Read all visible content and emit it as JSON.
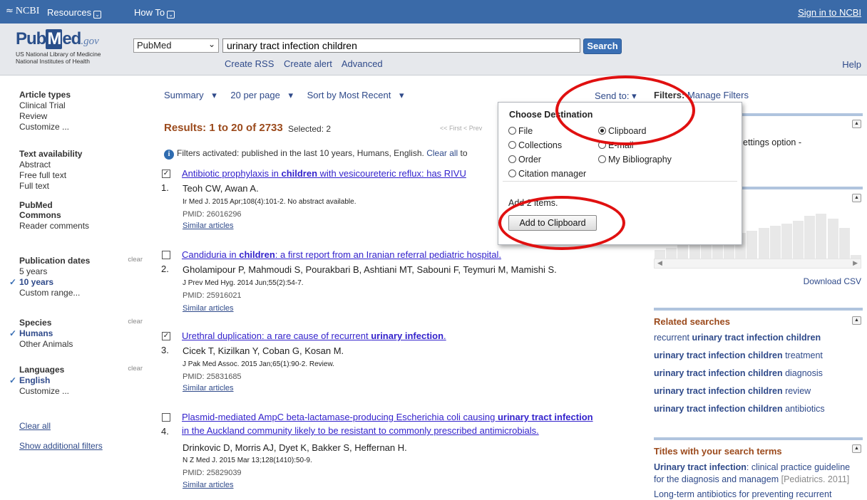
{
  "topbar": {
    "ncbi": "NCBI",
    "resources": "Resources",
    "howto": "How To",
    "signin": "Sign in to NCBI"
  },
  "header": {
    "logo_pub": "Pub",
    "logo_m": "M",
    "logo_ed": "ed",
    "logo_gov": ".gov",
    "lib1": "US National Library of Medicine",
    "lib2": "National Institutes of Health",
    "db": "PubMed",
    "query": "urinary tract infection children",
    "search": "Search",
    "create_rss": "Create RSS",
    "create_alert": "Create alert",
    "advanced": "Advanced",
    "help": "Help"
  },
  "filters_left": {
    "article_types": {
      "heading": "Article types",
      "items": [
        "Clinical Trial",
        "Review",
        "Customize ..."
      ]
    },
    "text_availability": {
      "heading": "Text availability",
      "items": [
        "Abstract",
        "Free full text",
        "Full text"
      ]
    },
    "pubmed_commons": {
      "heading1": "PubMed",
      "heading2": "Commons",
      "items": [
        "Reader comments"
      ]
    },
    "publication_dates": {
      "heading": "Publication dates",
      "clear": "clear",
      "items": [
        "5 years",
        "10 years",
        "Custom range..."
      ],
      "selected": "10 years"
    },
    "species": {
      "heading": "Species",
      "clear": "clear",
      "items": [
        "Humans",
        "Other Animals"
      ],
      "selected": "Humans"
    },
    "languages": {
      "heading": "Languages",
      "clear": "clear",
      "items": [
        "English",
        "Customize ..."
      ],
      "selected": "English"
    },
    "clear_all": "Clear all",
    "show_additional": "Show additional filters"
  },
  "display": {
    "format": "Summary",
    "per_page": "20 per page",
    "sort": "Sort by Most Recent",
    "send_to": "Send to:"
  },
  "results": {
    "text": "Results: 1 to 20 of 2733",
    "selected": "Selected: 2",
    "pager": "<< First   < Prev"
  },
  "filter_info": {
    "text": "Filters activated: published in the last 10 years, Humans, English.",
    "clear_all": "Clear all",
    "suffix": "to"
  },
  "articles": [
    {
      "num": "1.",
      "checked": true,
      "title_a": "Antibiotic prophylaxis in ",
      "title_b": "children",
      "title_c": " with vesicoureteric reflux: has RIVU",
      "authors": "Teoh CW, Awan A.",
      "journal": "Ir Med J. 2015 Apr;108(4):101-2. No abstract available.",
      "pmid": "PMID: 26016296",
      "similar": "Similar articles"
    },
    {
      "num": "2.",
      "checked": false,
      "title_a": "Candiduria in ",
      "title_b": "children",
      "title_c": ": a first report from an Iranian referral pediatric hospital.",
      "authors": "Gholamipour P, Mahmoudi S, Pourakbari B, Ashtiani MT, Sabouni F, Teymuri M, Mamishi S.",
      "journal": "J Prev Med Hyg. 2014 Jun;55(2):54-7.",
      "pmid": "PMID: 25916021",
      "similar": "Similar articles"
    },
    {
      "num": "3.",
      "checked": true,
      "title_a": "Urethral duplication: a rare cause of recurrent ",
      "title_b": "urinary infection",
      "title_c": ".",
      "authors": "Cicek T, Kizilkan Y, Coban G, Kosan M.",
      "journal": "J Pak Med Assoc. 2015 Jan;65(1):90-2. Review.",
      "pmid": "PMID: 25831685",
      "similar": "Similar articles"
    },
    {
      "num": "4.",
      "checked": false,
      "title_a": "Plasmid-mediated AmpC beta-lactamase-producing Escherichia coli causing ",
      "title_b": "urinary tract infection",
      "title_c": "",
      "title_line2": "in the Auckland community likely to be resistant to commonly prescribed antimicrobials.",
      "authors": "Drinkovic D, Morris AJ, Dyet K, Bakker S, Heffernan H.",
      "journal": "N Z Med J. 2015 Mar 13;128(1410):50-9.",
      "pmid": "PMID: 25829039",
      "similar": "Similar articles"
    }
  ],
  "popup": {
    "heading": "Choose Destination",
    "options": [
      "File",
      "Clipboard",
      "Collections",
      "E-mail",
      "Order",
      "My Bibliography",
      "Citation manager"
    ],
    "selected": "Clipboard",
    "add_items": "Add 2 items.",
    "button": "Add to Clipboard"
  },
  "right": {
    "filters_label": "Filters:",
    "manage": "Manage Filters",
    "settings_text": "ettings option -",
    "download_csv": "Download CSV",
    "histogram_levels": [
      0.25,
      0.3,
      0.35,
      0.4,
      0.45,
      0.5,
      0.55,
      0.6,
      0.65,
      0.7,
      0.75,
      0.8,
      0.85,
      0.95,
      1.0,
      0.9,
      0.7,
      0.15
    ],
    "related_heading": "Related searches",
    "related": [
      {
        "a": "recurrent ",
        "b": "urinary tract infection children",
        "c": ""
      },
      {
        "a": "",
        "b": "urinary tract infection children",
        "c": " treatment"
      },
      {
        "a": "",
        "b": "urinary tract infection children",
        "c": " diagnosis"
      },
      {
        "a": "",
        "b": "urinary tract infection children",
        "c": " review"
      },
      {
        "a": "",
        "b": "urinary tract infection children",
        "c": " antibiotics"
      }
    ],
    "titles_heading": "Titles with your search terms",
    "titles1_b": "Urinary tract infection",
    "titles1_a": ": clinical practice guideline",
    "titles1_line2": "for the diagnosis and managem",
    "titles1_cite": "[Pediatrics. 2011]",
    "titles2": "Long-term antibiotics for preventing recurrent"
  },
  "colors": {
    "topbar": "#3a6aa8",
    "results_heading": "#9b4a1c",
    "link": "#2f4a8a",
    "title_link": "#3322cc",
    "annotation": "#e01010"
  }
}
